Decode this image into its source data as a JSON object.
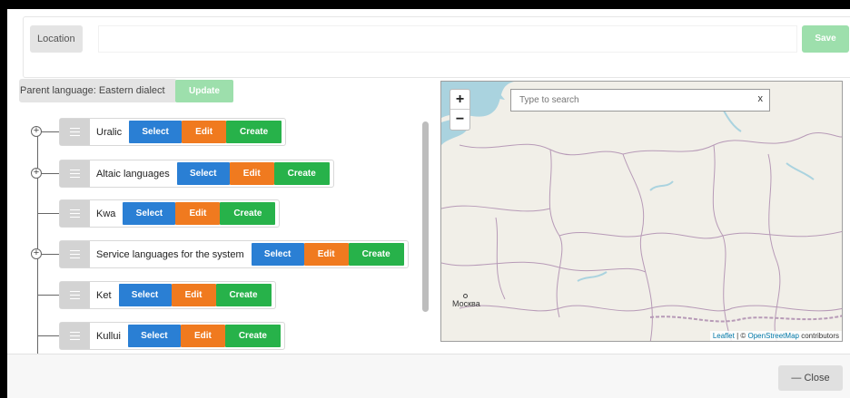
{
  "location": {
    "label": "Location",
    "value": "",
    "save_label": "Save"
  },
  "parent": {
    "label": "Parent language: Eastern dialect",
    "update_label": "Update"
  },
  "tree": {
    "nodes": [
      {
        "label": "Uralic",
        "select": "Select",
        "edit": "Edit",
        "create": "Create",
        "expandable": true
      },
      {
        "label": "Altaic languages",
        "select": "Select",
        "edit": "Edit",
        "create": "Create",
        "expandable": true
      },
      {
        "label": "Kwa",
        "select": "Select",
        "edit": "Edit",
        "create": "Create",
        "expandable": false
      },
      {
        "label": "Service languages for the system",
        "select": "Select",
        "edit": "Edit",
        "create": "Create",
        "expandable": true
      },
      {
        "label": "Ket",
        "select": "Select",
        "edit": "Edit",
        "create": "Create",
        "expandable": false
      },
      {
        "label": "Kullui",
        "select": "Select",
        "edit": "Edit",
        "create": "Create",
        "expandable": false
      }
    ]
  },
  "map": {
    "zoom_in": "+",
    "zoom_out": "−",
    "search_placeholder": "Type to search",
    "search_clear": "x",
    "city": "Москва",
    "attribution_leaflet": "Leaflet",
    "attribution_sep": " | © ",
    "attribution_osm": "OpenStreetMap",
    "attribution_tail": " contributors"
  },
  "footer": {
    "close_icon": "minus-icon",
    "close_label": "Close"
  }
}
